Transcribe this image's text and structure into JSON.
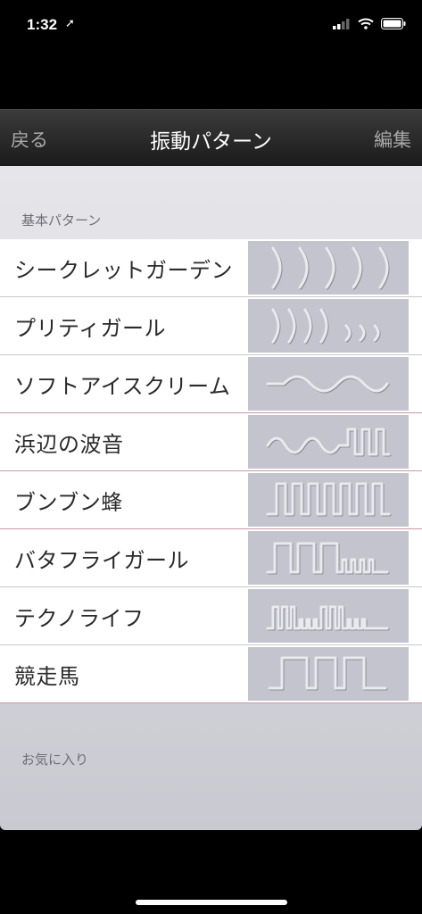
{
  "status_bar": {
    "time": "1:32",
    "location_icon": "location-arrow-icon",
    "signal_icon": "cellular-signal-icon",
    "wifi_icon": "wifi-icon",
    "battery_icon": "battery-icon"
  },
  "nav": {
    "back_label": "戻る",
    "title": "振動パターン",
    "edit_label": "編集"
  },
  "sections": {
    "basic_header": "基本パターン",
    "favorites_header": "お気に入り"
  },
  "patterns": [
    {
      "label": "シークレットガーデン",
      "icon": "arcs-large-pattern-icon"
    },
    {
      "label": "プリティガール",
      "icon": "arcs-decreasing-pattern-icon"
    },
    {
      "label": "ソフトアイスクリーム",
      "icon": "sine-wave-pattern-icon"
    },
    {
      "label": "浜辺の波音",
      "icon": "wave-then-pulse-pattern-icon"
    },
    {
      "label": "ブンブン蜂",
      "icon": "square-pulse-pattern-icon"
    },
    {
      "label": "バタフライガール",
      "icon": "pulse-decreasing-pattern-icon"
    },
    {
      "label": "テクノライフ",
      "icon": "techno-pulse-pattern-icon"
    },
    {
      "label": "競走馬",
      "icon": "gallop-pulse-pattern-icon"
    }
  ],
  "colors": {
    "thumb_bg": "#c4c4ce",
    "nav_bg": "#2a2a2a",
    "pink_separator": "#c59aa6"
  }
}
